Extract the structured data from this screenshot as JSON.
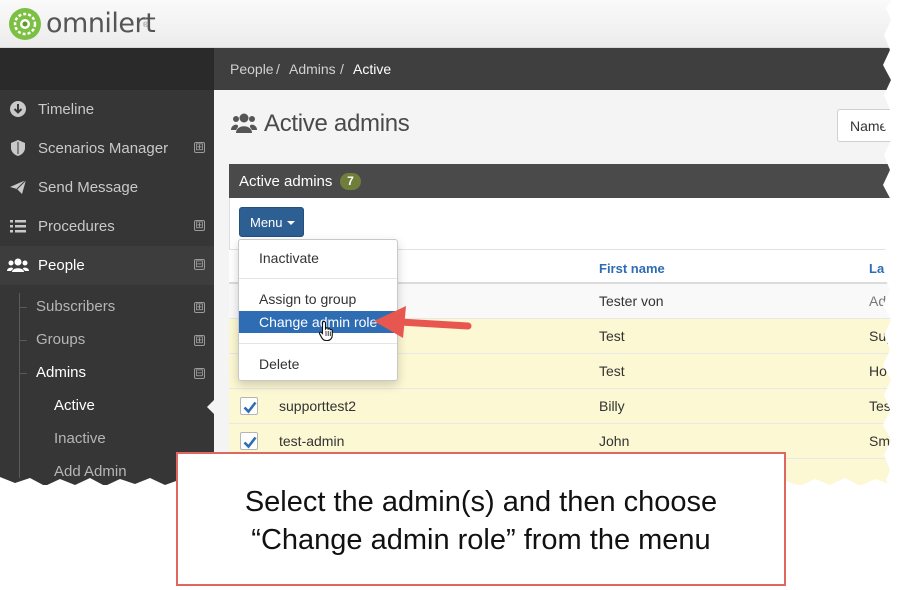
{
  "brand": {
    "name": "omnilert",
    "registered": "®",
    "colors": {
      "green": "#7bc043",
      "dark": "#363636",
      "accent": "#2e6db4"
    }
  },
  "sidebar": {
    "items": [
      {
        "label": "Timeline",
        "icon": "arrow-down-circle-icon",
        "toggle": ""
      },
      {
        "label": "Scenarios Manager",
        "icon": "shield-icon",
        "toggle": "⊞"
      },
      {
        "label": "Send Message",
        "icon": "paper-plane-icon",
        "toggle": ""
      },
      {
        "label": "Procedures",
        "icon": "list-icon",
        "toggle": "⊞"
      },
      {
        "label": "People",
        "icon": "users-icon",
        "toggle": "⊟"
      }
    ],
    "people_sub": [
      {
        "label": "Subscribers",
        "toggle": "⊞"
      },
      {
        "label": "Groups",
        "toggle": "⊞"
      },
      {
        "label": "Admins",
        "toggle": "⊟"
      }
    ],
    "admins_sub": [
      {
        "label": "Active"
      },
      {
        "label": "Inactive"
      },
      {
        "label": "Add Admin"
      }
    ]
  },
  "breadcrumb": {
    "items": [
      "People",
      "Admins",
      "Active"
    ],
    "separator": "/"
  },
  "page": {
    "title": "Active admins",
    "sort_button": "Name"
  },
  "panel": {
    "title": "Active admins",
    "count": "7"
  },
  "menu": {
    "button_label": "Menu",
    "items": [
      "Inactivate",
      "Assign to group",
      "Change admin role",
      "Delete"
    ],
    "highlighted": "Change admin role"
  },
  "table": {
    "headers": {
      "first_name": "First name",
      "last_name": "La"
    },
    "rows": [
      {
        "username": "",
        "first_name": "Tester von",
        "last_name": "Adr",
        "checked": false
      },
      {
        "username": "",
        "first_name": "Test",
        "last_name": "Sup",
        "checked": true
      },
      {
        "username": "",
        "first_name": "Test",
        "last_name": "Hov",
        "checked": true
      },
      {
        "username": "supporttest2",
        "first_name": "Billy",
        "last_name": "Tes",
        "checked": true
      },
      {
        "username": "test-admin",
        "first_name": "John",
        "last_name": "Smi",
        "checked": true
      }
    ]
  },
  "callout": {
    "line1": "Select the admin(s) and then choose",
    "line2": "“Change admin role” from the menu",
    "border_color": "#e06660"
  }
}
